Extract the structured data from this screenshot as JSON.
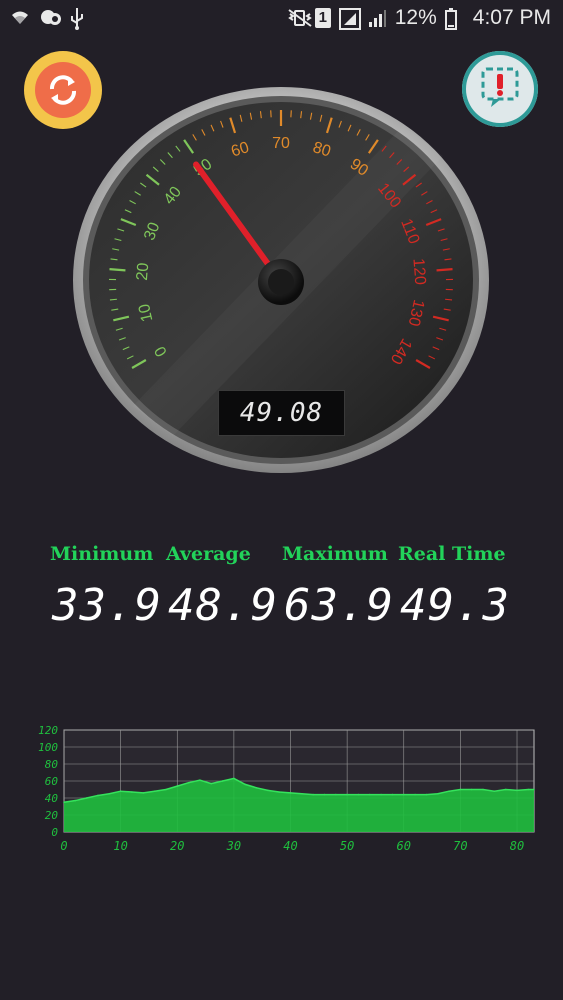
{
  "status_bar": {
    "battery": "12%",
    "time": "4:07 PM",
    "sim": "1"
  },
  "gauge": {
    "min": 0,
    "max": 140,
    "ticks": [
      "0",
      "10",
      "20",
      "30",
      "40",
      "50",
      "60",
      "70",
      "80",
      "90",
      "100",
      "110",
      "120",
      "130",
      "140"
    ],
    "needle_value": 49.08,
    "digital_readout": "49.08"
  },
  "stats": {
    "minimum_label": "Minimum",
    "average_label": "Average",
    "maximum_label": "Maximum",
    "realtime_label": "Real Time",
    "minimum_value": "33.9",
    "average_value": "48.9",
    "maximum_value": "63.9",
    "realtime_value": "49.3"
  },
  "colors": {
    "background": "#221f27",
    "accent_green": "#22d35a",
    "needle": "#e0202a",
    "refresh_outer": "#f3c54a",
    "refresh_inner": "#ef6d49"
  },
  "chart_data": {
    "type": "area",
    "x": [
      0,
      2,
      4,
      6,
      8,
      10,
      12,
      14,
      16,
      18,
      20,
      22,
      24,
      26,
      28,
      30,
      32,
      34,
      36,
      38,
      40,
      42,
      44,
      46,
      48,
      50,
      52,
      54,
      56,
      58,
      60,
      62,
      64,
      66,
      68,
      70,
      72,
      74,
      76,
      78,
      80,
      82,
      83
    ],
    "values": [
      35,
      37,
      40,
      43,
      45,
      48,
      47,
      46,
      48,
      50,
      54,
      58,
      61,
      57,
      60,
      63,
      56,
      52,
      49,
      47,
      46,
      45,
      44,
      44,
      44,
      44,
      44,
      44,
      44,
      44,
      44,
      44,
      44,
      45,
      48,
      50,
      50,
      50,
      48,
      50,
      49,
      50,
      50
    ],
    "x_ticks": [
      "0",
      "10",
      "20",
      "30",
      "40",
      "50",
      "60",
      "70",
      "80"
    ],
    "y_ticks": [
      "0",
      "20",
      "40",
      "60",
      "80",
      "100",
      "120"
    ],
    "xlim": [
      0,
      83
    ],
    "ylim": [
      0,
      120
    ],
    "grid": true,
    "color": "#1fbf3e"
  }
}
